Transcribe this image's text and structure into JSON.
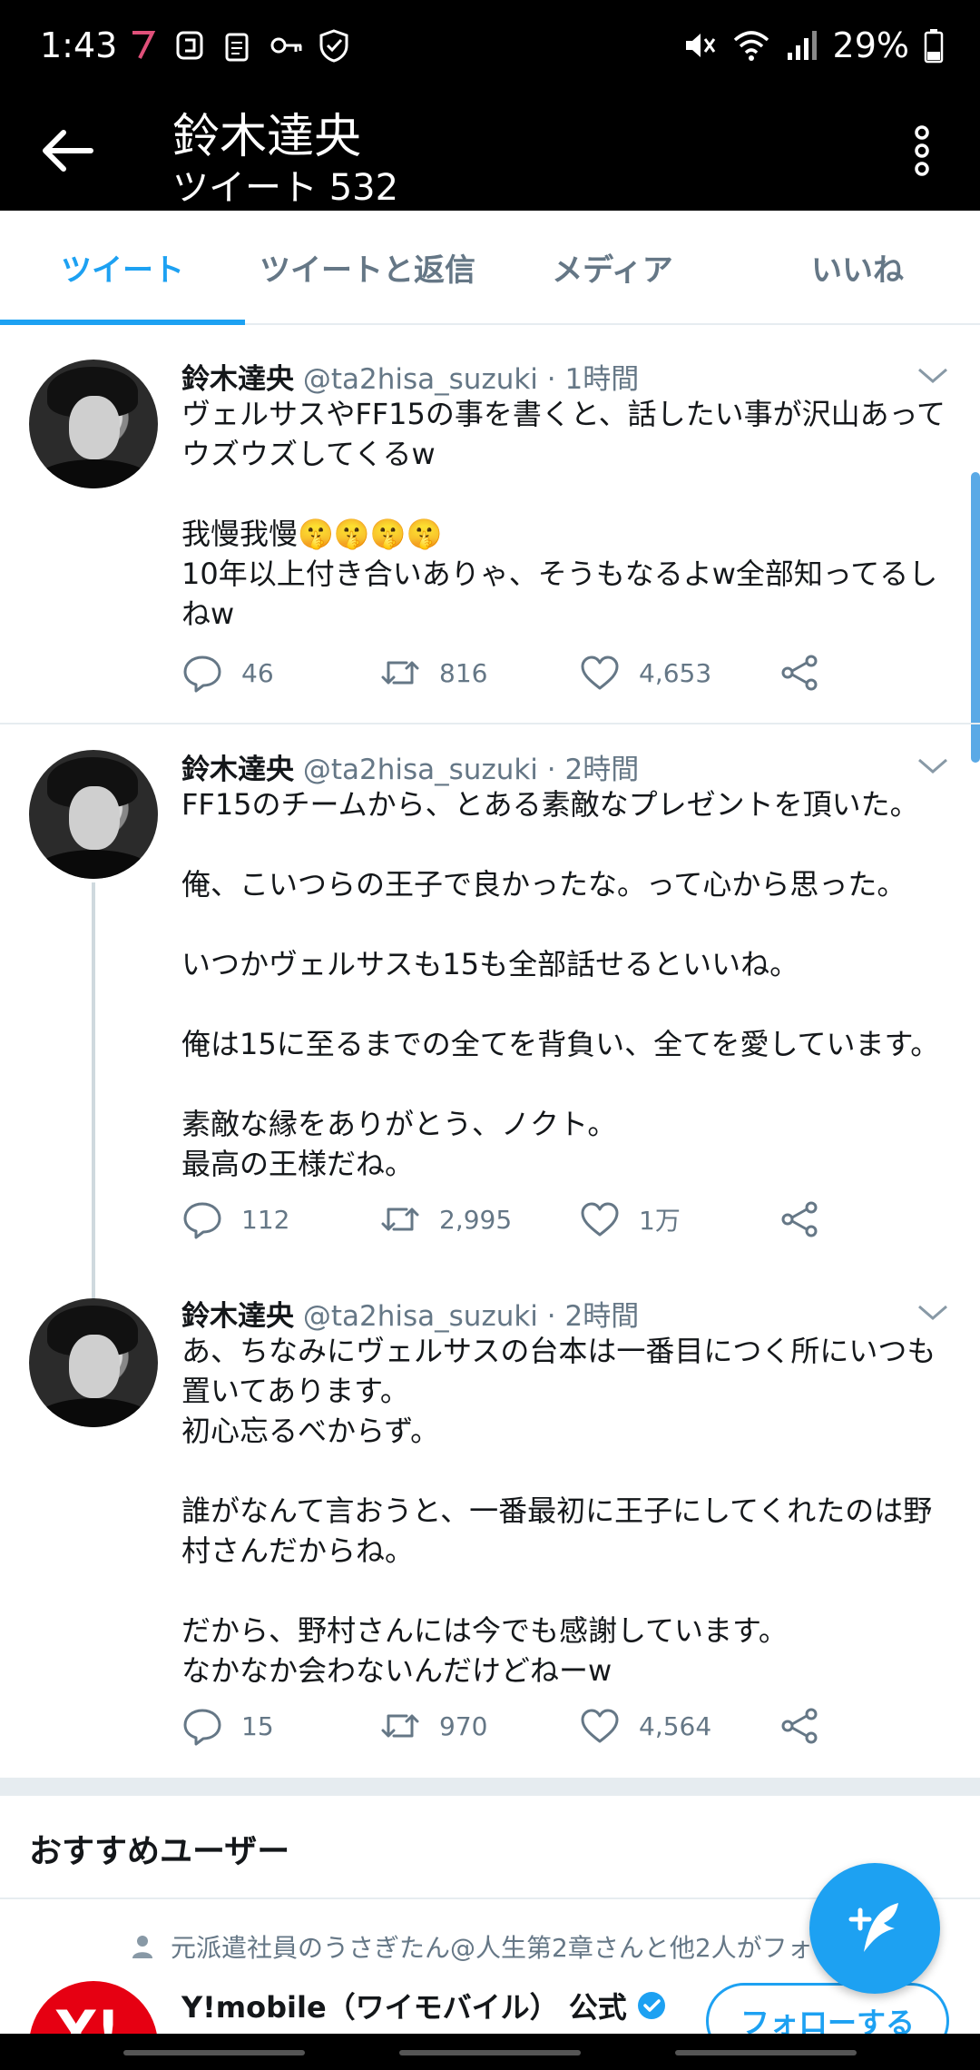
{
  "status_bar": {
    "time": "1:43",
    "battery": "29%"
  },
  "header": {
    "name": "鈴木達央",
    "tweet_count": "ツイート 532"
  },
  "tabs": [
    {
      "label": "ツイート",
      "active": true
    },
    {
      "label": "ツイートと返信",
      "active": false
    },
    {
      "label": "メディア",
      "active": false
    },
    {
      "label": "いいね",
      "active": false
    }
  ],
  "tweets": [
    {
      "display_name": "鈴木達央",
      "meta": "@ta2hisa_suzuki · 1時間",
      "text": "ヴェルサスやFF15の事を書くと、話したい事が沢山あってウズウズしてくるw\n\n我慢我慢🤫🤫🤫🤫\n10年以上付き合いありゃ、そうもなるよw全部知ってるしねw",
      "replies": "46",
      "retweets": "816",
      "likes": "4,653"
    },
    {
      "display_name": "鈴木達央",
      "meta": "@ta2hisa_suzuki · 2時間",
      "text": "FF15のチームから、とある素敵なプレゼントを頂いた。\n\n俺、こいつらの王子で良かったな。って心から思った。\n\nいつかヴェルサスも15も全部話せるといいね。\n\n俺は15に至るまでの全てを背負い、全てを愛しています。\n\n素敵な縁をありがとう、ノクト。\n最高の王様だね。",
      "replies": "112",
      "retweets": "2,995",
      "likes": "1万"
    },
    {
      "display_name": "鈴木達央",
      "meta": "@ta2hisa_suzuki · 2時間",
      "text": "あ、ちなみにヴェルサスの台本は一番目につく所にいつも置いてあります。\n初心忘るべからず。\n\n誰がなんて言おうと、一番最初に王子にしてくれたのは野村さんだからね。\n\nだから、野村さんには今でも感謝しています。\nなかなか会わないんだけどねーw",
      "replies": "15",
      "retweets": "970",
      "likes": "4,564"
    }
  ],
  "recommended": {
    "title": "おすすめユーザー",
    "context": "元派遣社員のうさぎたん@人生第2章さんと他2人がフォ",
    "user_name": "Y!mobile（ワイモバイル） 公式",
    "avatar_text": "Y!",
    "follow_label": "フォローする"
  },
  "colors": {
    "accent": "#1da1f2",
    "secondary_text": "#657786"
  }
}
